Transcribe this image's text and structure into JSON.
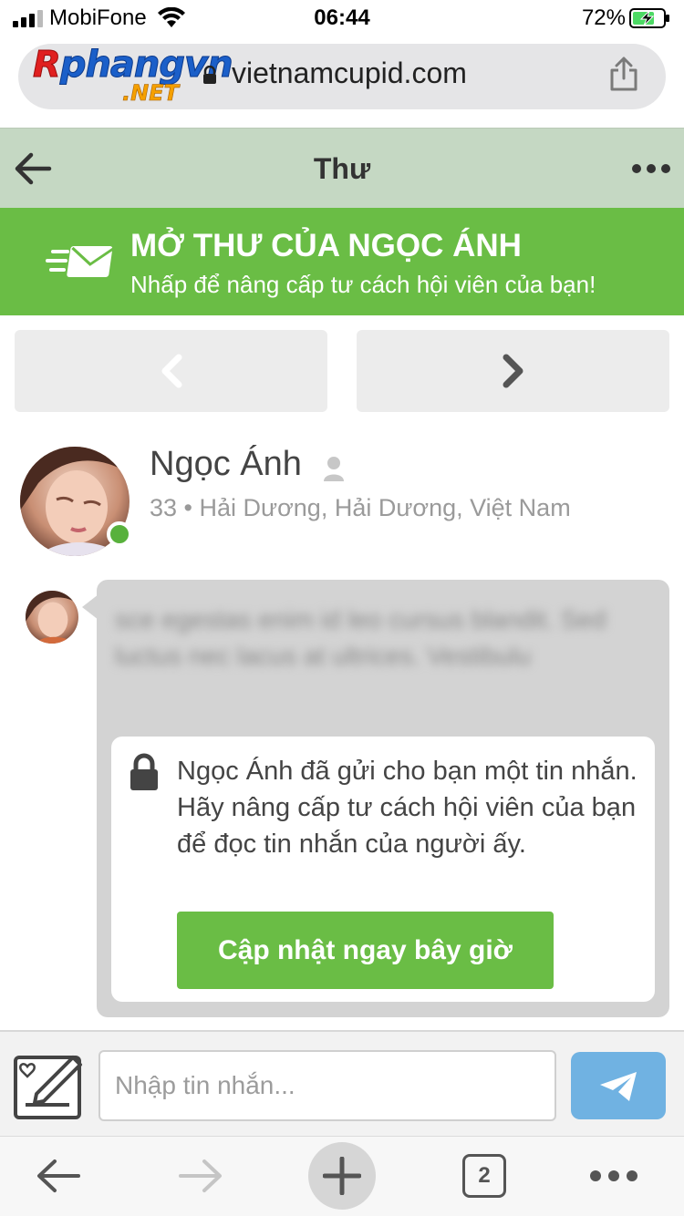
{
  "status_bar": {
    "carrier": "MobiFone",
    "time": "06:44",
    "battery_percent": "72%",
    "battery_level": 0.72,
    "charging": true
  },
  "browser": {
    "url": "vietnamcupid.com",
    "watermark": {
      "line1_r": "R",
      "line1_rest": "phangvn",
      "line2": ".NET"
    },
    "message_placeholder": "Nhập tin nhắn...",
    "tab_count": "2"
  },
  "header": {
    "title": "Thư"
  },
  "banner": {
    "title": "MỞ THƯ CỦA NGỌC ÁNH",
    "subtitle": "Nhấp để nâng cấp tư cách hội viên của bạn!"
  },
  "profile": {
    "name": "Ngọc Ánh",
    "details": "33 • Hải Dương, Hải Dương, Việt Nam",
    "online": true
  },
  "message": {
    "blurred_text": "sce egestas enim id leo cursus blandit. Sed luctus nec lacus at ultrices. Vestibulu",
    "locked_notice": "Ngọc Ánh đã gửi cho bạn một tin nhắn. Hãy nâng cấp tư cách hội viên của bạn để đọc tin nhắn của người ấy.",
    "upgrade_label": "Cập nhật ngay bây giờ"
  },
  "colors": {
    "accent_green": "#6abd45",
    "header_bg": "#c5d8c3",
    "send_blue": "#70b2e2",
    "online_green": "#58b13c"
  },
  "icons": {
    "back": "arrow-left-icon",
    "more": "ellipsis-icon",
    "mail": "mail-fast-icon",
    "prev": "chevron-left-icon",
    "next": "chevron-right-icon",
    "person": "person-icon",
    "lock": "lock-icon",
    "compose": "compose-icon",
    "send": "send-icon",
    "share": "share-icon",
    "new_tab": "plus-icon"
  }
}
